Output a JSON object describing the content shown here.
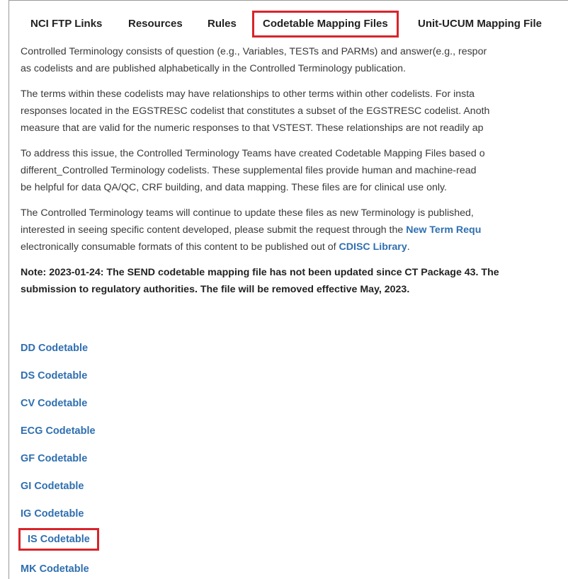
{
  "tabs": [
    {
      "label": "NCI FTP Links"
    },
    {
      "label": "Resources"
    },
    {
      "label": "Rules"
    },
    {
      "label": "Codetable Mapping Files"
    },
    {
      "label": "Unit-UCUM Mapping File"
    }
  ],
  "paragraphs": {
    "p1_line1": "Controlled Terminology consists of question (e.g., Variables, TESTs and PARMs) and answer(e.g., respor",
    "p1_line2": "as codelists and are published alphabetically in the Controlled Terminology publication.",
    "p2_line1": "The terms within these codelists may have relationships to other terms within other codelists. For insta",
    "p2_line2": "responses located in the EGSTRESC codelist that constitutes a subset of the EGSTRESC codelist. Anoth",
    "p2_line3": "measure that are valid for the numeric responses to that VSTEST. These relationships are not readily ap",
    "p3_line1": "To address this issue, the Controlled Terminology Teams have created Codetable Mapping Files based o",
    "p3_line2": "different_Controlled Terminology codelists. These supplemental files provide human and machine-read",
    "p3_line3": "be helpful for data QA/QC, CRF building, and data mapping. These files are for clinical use only.",
    "p4_line1": "The Controlled Terminology teams will continue to update these files as new Terminology is published,",
    "p4_line2_text": "interested in seeing specific content developed, please submit the request through the ",
    "p4_line2_link": "New Term Requ",
    "p4_line3_text": "electronically consumable formats of this content to be published out of ",
    "p4_line3_link": "CDISC Library",
    "p4_line3_end": "."
  },
  "note": {
    "line1": "Note: 2023-01-24: The SEND codetable mapping file has not been updated since CT Package 43. The",
    "line2": "submission to regulatory authorities. The file will be removed effective May, 2023."
  },
  "codetables": [
    {
      "label": "DD Codetable"
    },
    {
      "label": "DS Codetable"
    },
    {
      "label": "CV Codetable"
    },
    {
      "label": "ECG Codetable"
    },
    {
      "label": "GF Codetable"
    },
    {
      "label": "GI Codetable"
    },
    {
      "label": "IG Codetable"
    },
    {
      "label": "IS Codetable"
    },
    {
      "label": "MK Codetable"
    }
  ],
  "colors": {
    "link": "#2f6fb0",
    "highlight": "#d8242b"
  }
}
